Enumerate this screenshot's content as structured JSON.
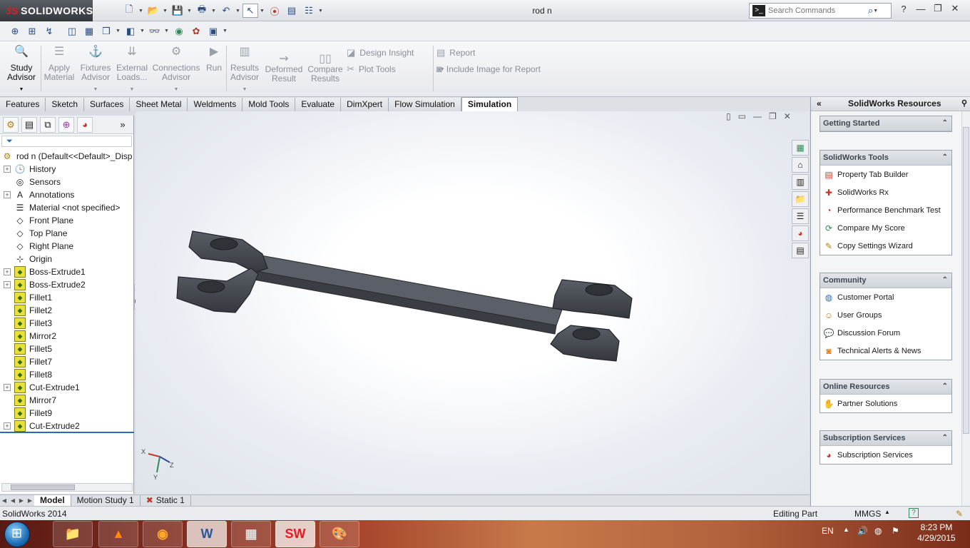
{
  "app": {
    "brand": "SOLIDWORKS",
    "brand_prefix": "3S",
    "doc_title": "rod n"
  },
  "search": {
    "placeholder": "Search Commands"
  },
  "window": {
    "help": "?",
    "minimize": "—",
    "restore": "❐",
    "close": "✕"
  },
  "command_manager": {
    "study_advisor": "Study Advisor",
    "apply_material": "Apply Material",
    "fixtures_advisor": "Fixtures Advisor",
    "external_loads": "External Loads...",
    "connections_advisor": "Connections Advisor",
    "run": "Run",
    "results_advisor": "Results Advisor",
    "deformed_result": "Deformed Result",
    "compare_results": "Compare Results",
    "design_insight": "Design Insight",
    "plot_tools": "Plot Tools",
    "report": "Report",
    "include_image": "Include Image for Report"
  },
  "tabs": [
    "Features",
    "Sketch",
    "Surfaces",
    "Sheet Metal",
    "Weldments",
    "Mold Tools",
    "Evaluate",
    "DimXpert",
    "Flow Simulation",
    "Simulation"
  ],
  "active_tab": "Simulation",
  "tree": {
    "root": "rod n  (Default<<Default>_Disp",
    "nodes": [
      {
        "label": "History",
        "exp": true
      },
      {
        "label": "Sensors",
        "exp": false
      },
      {
        "label": "Annotations",
        "exp": true
      },
      {
        "label": "Material <not specified>",
        "exp": false
      },
      {
        "label": "Front Plane",
        "exp": false
      },
      {
        "label": "Top Plane",
        "exp": false
      },
      {
        "label": "Right Plane",
        "exp": false
      },
      {
        "label": "Origin",
        "exp": false
      },
      {
        "label": "Boss-Extrude1",
        "exp": true
      },
      {
        "label": "Boss-Extrude2",
        "exp": true
      },
      {
        "label": "Fillet1",
        "exp": false
      },
      {
        "label": "Fillet2",
        "exp": false
      },
      {
        "label": "Fillet3",
        "exp": false
      },
      {
        "label": "Mirror2",
        "exp": false
      },
      {
        "label": "Fillet5",
        "exp": false
      },
      {
        "label": "Fillet7",
        "exp": false
      },
      {
        "label": "Fillet8",
        "exp": false
      },
      {
        "label": "Cut-Extrude1",
        "exp": true
      },
      {
        "label": "Mirror7",
        "exp": false
      },
      {
        "label": "Fillet9",
        "exp": false
      },
      {
        "label": "Cut-Extrude2",
        "exp": true
      }
    ]
  },
  "bottom_tabs": [
    "Model",
    "Motion Study 1",
    "Static 1"
  ],
  "taskpane": {
    "title": "SolidWorks Resources",
    "groups": [
      {
        "title": "Getting Started",
        "items": []
      },
      {
        "title": "SolidWorks Tools",
        "items": [
          "Property Tab Builder",
          "SolidWorks Rx",
          "Performance Benchmark Test",
          "Compare My Score",
          "Copy Settings Wizard"
        ]
      },
      {
        "title": "Community",
        "items": [
          "Customer Portal",
          "User Groups",
          "Discussion Forum",
          "Technical Alerts & News"
        ]
      },
      {
        "title": "Online Resources",
        "items": [
          "Partner Solutions"
        ]
      },
      {
        "title": "Subscription Services",
        "items": [
          "Subscription Services"
        ]
      }
    ]
  },
  "status": {
    "product": "SolidWorks 2014",
    "mode": "Editing Part",
    "units": "MMGS"
  },
  "taskbar": {
    "lang": "EN",
    "time": "8:23 PM",
    "date": "4/29/2015"
  },
  "triad": {
    "x": "X",
    "y": "Y",
    "z": "Z"
  },
  "colors": {
    "part": "#4a4d54",
    "accent": "#2b6cb0",
    "brand_red": "#e31b23"
  }
}
